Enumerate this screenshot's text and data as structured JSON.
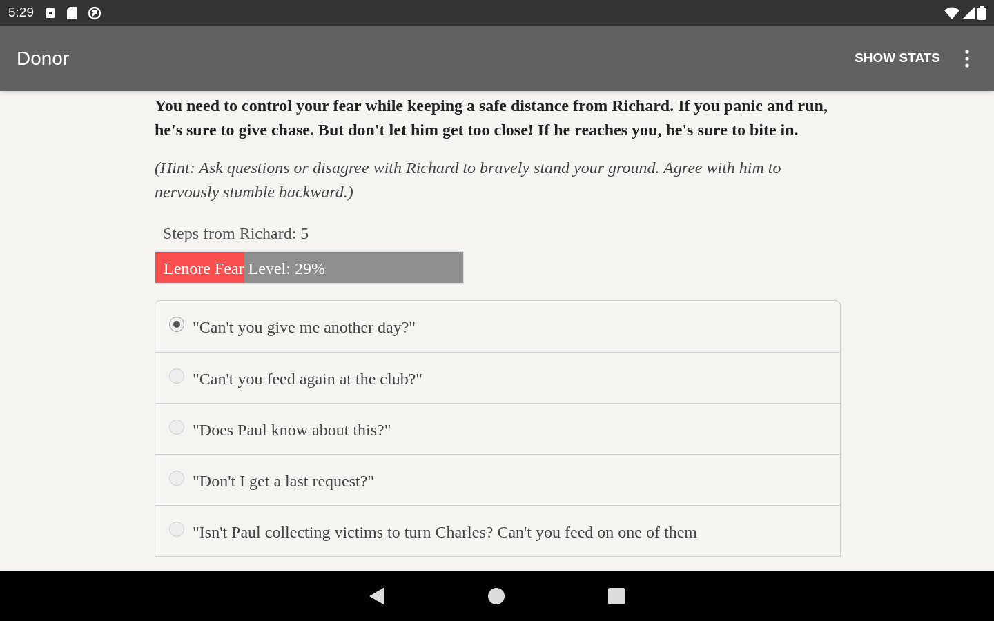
{
  "status_bar": {
    "time": "5:29"
  },
  "app_bar": {
    "title": "Donor",
    "action": "SHOW STATS"
  },
  "story": {
    "text": "You need to control your fear while keeping a safe distance from Richard. If you panic and run, he's sure to give chase. But don't let him get too close! If he reaches you, he's sure to bite in.",
    "hint": "(Hint: Ask questions or disagree with Richard to bravely stand your ground. Agree with him to nervously stumble backward.)"
  },
  "steps": "Steps from Richard: 5",
  "fear_bar": {
    "label": "Lenore Fear Level: 29%",
    "level": 0.29
  },
  "options": [
    {
      "label": "\"Can't you give me another day?\"",
      "selected": true
    },
    {
      "label": "\"Can't you feed again at the club?\"",
      "selected": false
    },
    {
      "label": "\"Does Paul know about this?\"",
      "selected": false
    },
    {
      "label": "\"Don't I get a last request?\"",
      "selected": false
    },
    {
      "label": "\"Isn't Paul collecting victims to turn Charles? Can't you feed on one of them",
      "selected": false
    }
  ]
}
